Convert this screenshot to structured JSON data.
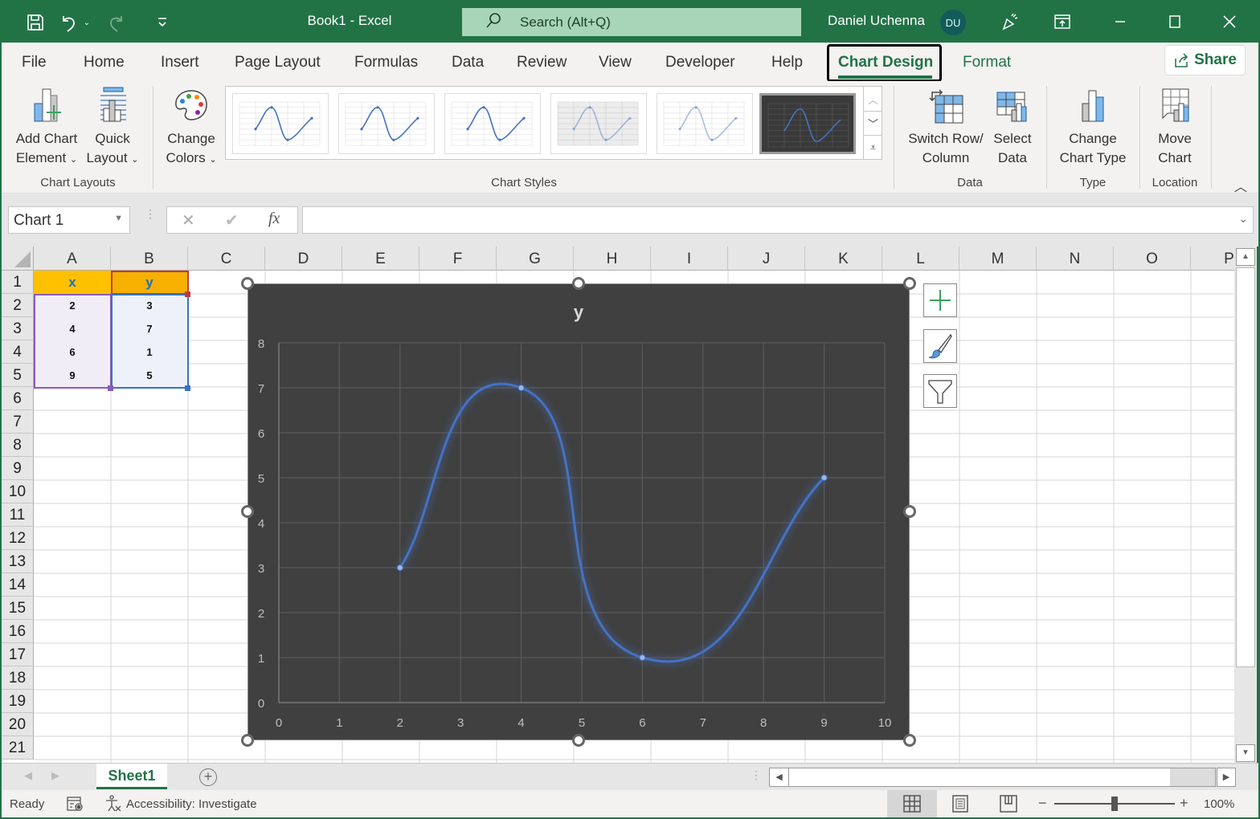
{
  "titlebar": {
    "doc_title": "Book1  -  Excel",
    "search_placeholder": "Search (Alt+Q)",
    "user_name": "Daniel Uchenna",
    "user_initials": "DU"
  },
  "ribbon_tabs": [
    "File",
    "Home",
    "Insert",
    "Page Layout",
    "Formulas",
    "Data",
    "Review",
    "View",
    "Developer",
    "Help",
    "Chart Design",
    "Format"
  ],
  "active_tab": "Chart Design",
  "share_label": "Share",
  "ribbon": {
    "add_chart_element": [
      "Add Chart",
      "Element"
    ],
    "quick_layout": [
      "Quick",
      "Layout"
    ],
    "change_colors": [
      "Change",
      "Colors"
    ],
    "switch_row_col": [
      "Switch Row/",
      "Column"
    ],
    "select_data": [
      "Select",
      "Data"
    ],
    "change_chart_type": [
      "Change",
      "Chart Type"
    ],
    "move_chart": [
      "Move",
      "Chart"
    ],
    "groups": {
      "chart_layouts": "Chart Layouts",
      "chart_styles": "Chart Styles",
      "data": "Data",
      "type": "Type",
      "location": "Location"
    },
    "style_count": 6,
    "selected_style": 6
  },
  "formula_bar": {
    "name_box": "Chart 1",
    "cancel_icon": "✕",
    "enter_icon": "✔",
    "fx": "fx",
    "formula": ""
  },
  "columns": [
    "A",
    "B",
    "C",
    "D",
    "E",
    "F",
    "G",
    "H",
    "I",
    "J",
    "K",
    "L",
    "M",
    "N",
    "O",
    "P"
  ],
  "rows": [
    "1",
    "2",
    "3",
    "4",
    "5",
    "6",
    "7",
    "8",
    "9",
    "10",
    "11",
    "12",
    "13",
    "14",
    "15",
    "16",
    "17",
    "18",
    "19",
    "20",
    "21"
  ],
  "cells": {
    "A1": "x",
    "B1": "y",
    "A2": "2",
    "B2": "3",
    "A3": "4",
    "B3": "7",
    "A4": "6",
    "B4": "1",
    "A5": "9",
    "B5": "5"
  },
  "chart_data": {
    "type": "scatter",
    "subtype": "smooth lines with markers",
    "title": "y",
    "series": [
      {
        "name": "y",
        "x": [
          2,
          4,
          6,
          9
        ],
        "y": [
          3,
          7,
          1,
          5
        ],
        "color": "#4472c4"
      }
    ],
    "xlim": [
      0,
      10
    ],
    "ylim": [
      0,
      8
    ],
    "xticks": [
      "0",
      "1",
      "2",
      "3",
      "4",
      "5",
      "6",
      "7",
      "8",
      "9",
      "10"
    ],
    "yticks": [
      "0",
      "1",
      "2",
      "3",
      "4",
      "5",
      "6",
      "7",
      "8"
    ],
    "grid": true,
    "background": "#404040",
    "xlabel": "",
    "ylabel": ""
  },
  "sheets": [
    "Sheet1"
  ],
  "status": {
    "ready": "Ready",
    "accessibility": "Accessibility: Investigate",
    "zoom": "100%",
    "zoom_value_percent": 100
  },
  "colors": {
    "brand": "#217346",
    "header_fill_x": "#ffc000",
    "header_fill_y": "#f5b000",
    "series": "#4472c4"
  }
}
